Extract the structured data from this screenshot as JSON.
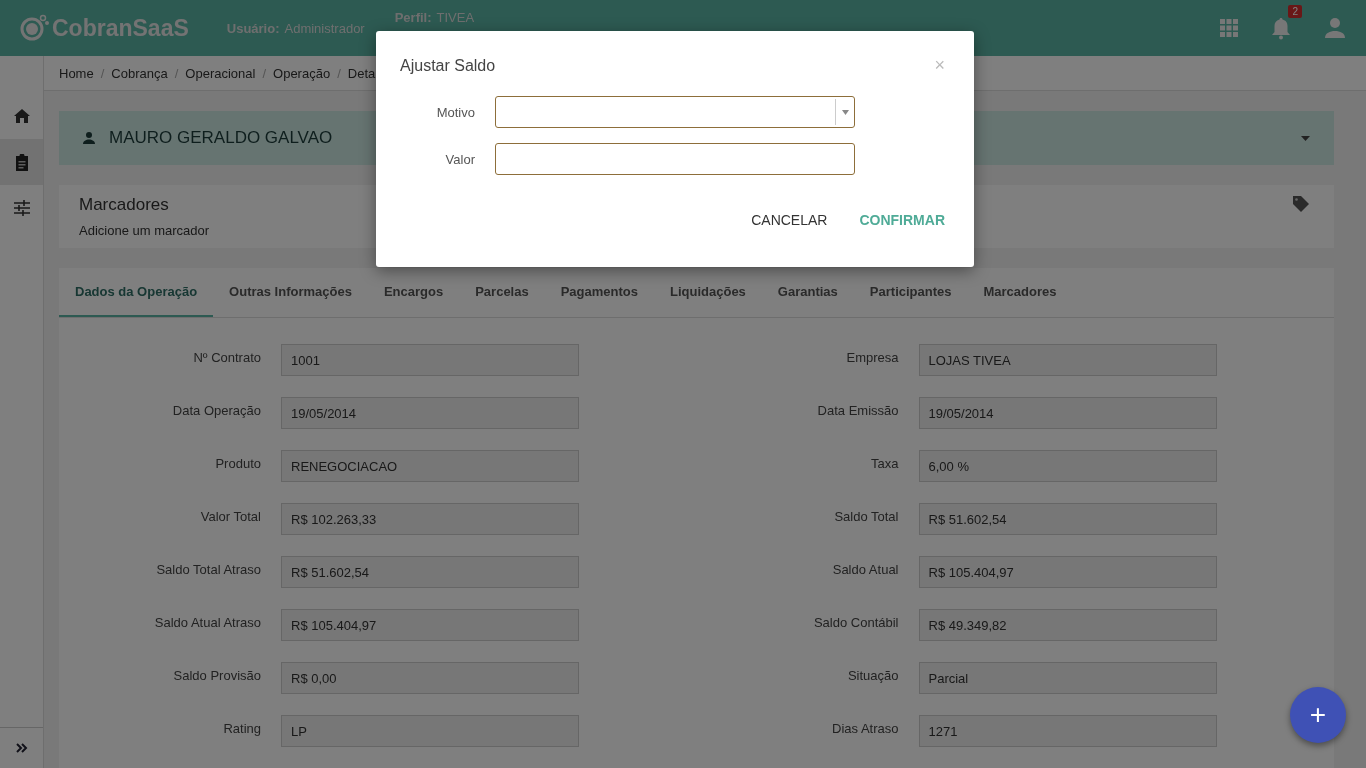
{
  "header": {
    "logo": "CobranSaaS",
    "user_label": "Usuário:",
    "user": "Administrador",
    "profile_label": "Perfil:",
    "profile": "TIVEA",
    "notifications": "2"
  },
  "sidebar": {
    "items": [
      {
        "kind": "home",
        "selected": false
      },
      {
        "kind": "clipboard",
        "selected": true
      },
      {
        "kind": "sliders",
        "selected": false
      }
    ]
  },
  "breadcrumb": [
    {
      "kind": "link",
      "text": "Home"
    },
    {
      "kind": "separator",
      "text": "/"
    },
    {
      "kind": "link",
      "text": "Cobrança"
    },
    {
      "kind": "separator",
      "text": "/"
    },
    {
      "kind": "link",
      "text": "Operacional"
    },
    {
      "kind": "separator",
      "text": "/"
    },
    {
      "kind": "link",
      "text": "Operação"
    },
    {
      "kind": "separator",
      "text": "/"
    },
    {
      "kind": "link",
      "text": "Deta"
    }
  ],
  "person": {
    "name": "MAURO GERALDO GALVAO"
  },
  "markers": {
    "title": "Marcadores",
    "hint": "Adicione um marcador"
  },
  "tabs": [
    {
      "label": "Dados da Operação",
      "selected": true
    },
    {
      "label": "Outras Informações",
      "selected": false
    },
    {
      "label": "Encargos",
      "selected": false
    },
    {
      "label": "Parcelas",
      "selected": false
    },
    {
      "label": "Pagamentos",
      "selected": false
    },
    {
      "label": "Liquidações",
      "selected": false
    },
    {
      "label": "Garantias",
      "selected": false
    },
    {
      "label": "Participantes",
      "selected": false
    },
    {
      "label": "Marcadores",
      "selected": false
    }
  ],
  "fields": [
    {
      "label": "Nº Contrato",
      "value": "1001"
    },
    {
      "label": "Empresa",
      "value": "LOJAS TIVEA"
    },
    {
      "label": "Data Operação",
      "value": "19/05/2014"
    },
    {
      "label": "Data Emissão",
      "value": "19/05/2014"
    },
    {
      "label": "Produto",
      "value": "RENEGOCIACAO"
    },
    {
      "label": "Taxa",
      "value": "6,00 %"
    },
    {
      "label": "Valor Total",
      "value": "R$ 102.263,33"
    },
    {
      "label": "Saldo Total",
      "value": "R$ 51.602,54"
    },
    {
      "label": "Saldo Total Atraso",
      "value": "R$ 51.602,54"
    },
    {
      "label": "Saldo Atual",
      "value": "R$ 105.404,97"
    },
    {
      "label": "Saldo Atual Atraso",
      "value": "R$ 105.404,97"
    },
    {
      "label": "Saldo Contábil",
      "value": "R$ 49.349,82"
    },
    {
      "label": "Saldo Provisão",
      "value": "R$ 0,00"
    },
    {
      "label": "Situação",
      "value": "Parcial"
    },
    {
      "label": "Rating",
      "value": "LP"
    },
    {
      "label": "Dias Atraso",
      "value": "1271"
    }
  ],
  "fab": "+",
  "dialog": {
    "title": "Ajustar Saldo",
    "close": "×",
    "fields": [
      {
        "kind": "select",
        "label": "Motivo"
      },
      {
        "kind": "text",
        "label": "Valor"
      }
    ],
    "buttons": [
      {
        "label": "CANCELAR",
        "kind": "plain"
      },
      {
        "label": "CONFIRMAR",
        "kind": "primary"
      }
    ]
  }
}
